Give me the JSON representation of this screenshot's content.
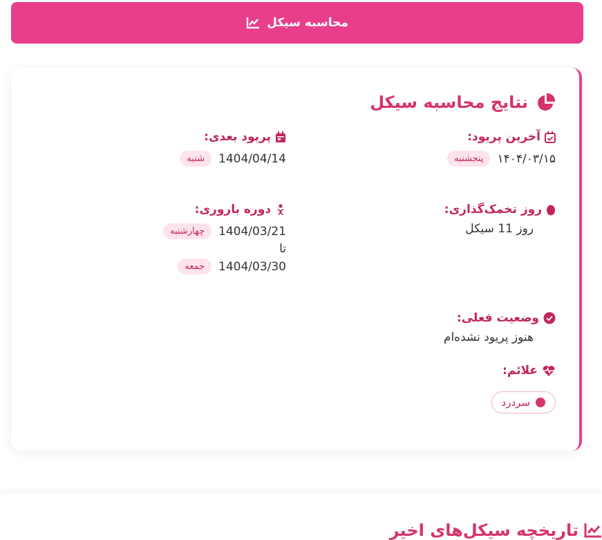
{
  "calc_button": {
    "label": "محاسبه سیکل",
    "icon": "chart-line-icon"
  },
  "results": {
    "title": "نتایج محاسبه سیکل",
    "last_period": {
      "label": "آخرین پریود:",
      "date": "۱۴۰۴/۰۳/۱۵",
      "weekday": "پنجشنبه"
    },
    "next_period": {
      "label": "پریود بعدی:",
      "date": "1404/04/14",
      "weekday": "شنبه"
    },
    "ovulation": {
      "label": "روز تخمک‌گذاری:",
      "value": "روز 11 سیکل"
    },
    "fertile": {
      "label": "دوره باروری:",
      "start_date": "1404/03/21",
      "start_weekday": "چهارشنبه",
      "to": "تا",
      "end_date": "1404/03/30",
      "end_weekday": "جمعه"
    },
    "status": {
      "label": "وضعیت فعلی:",
      "value": "هنوز پریود نشده‌ام"
    },
    "symptoms": {
      "label": "علائم:",
      "items": [
        "سردرد"
      ]
    }
  },
  "history": {
    "title": "تاریخچه سیکل‌های اخیر"
  },
  "colors": {
    "accent": "#e83e8c",
    "accent_dark": "#c2255c",
    "badge_bg": "#fde3ec"
  }
}
